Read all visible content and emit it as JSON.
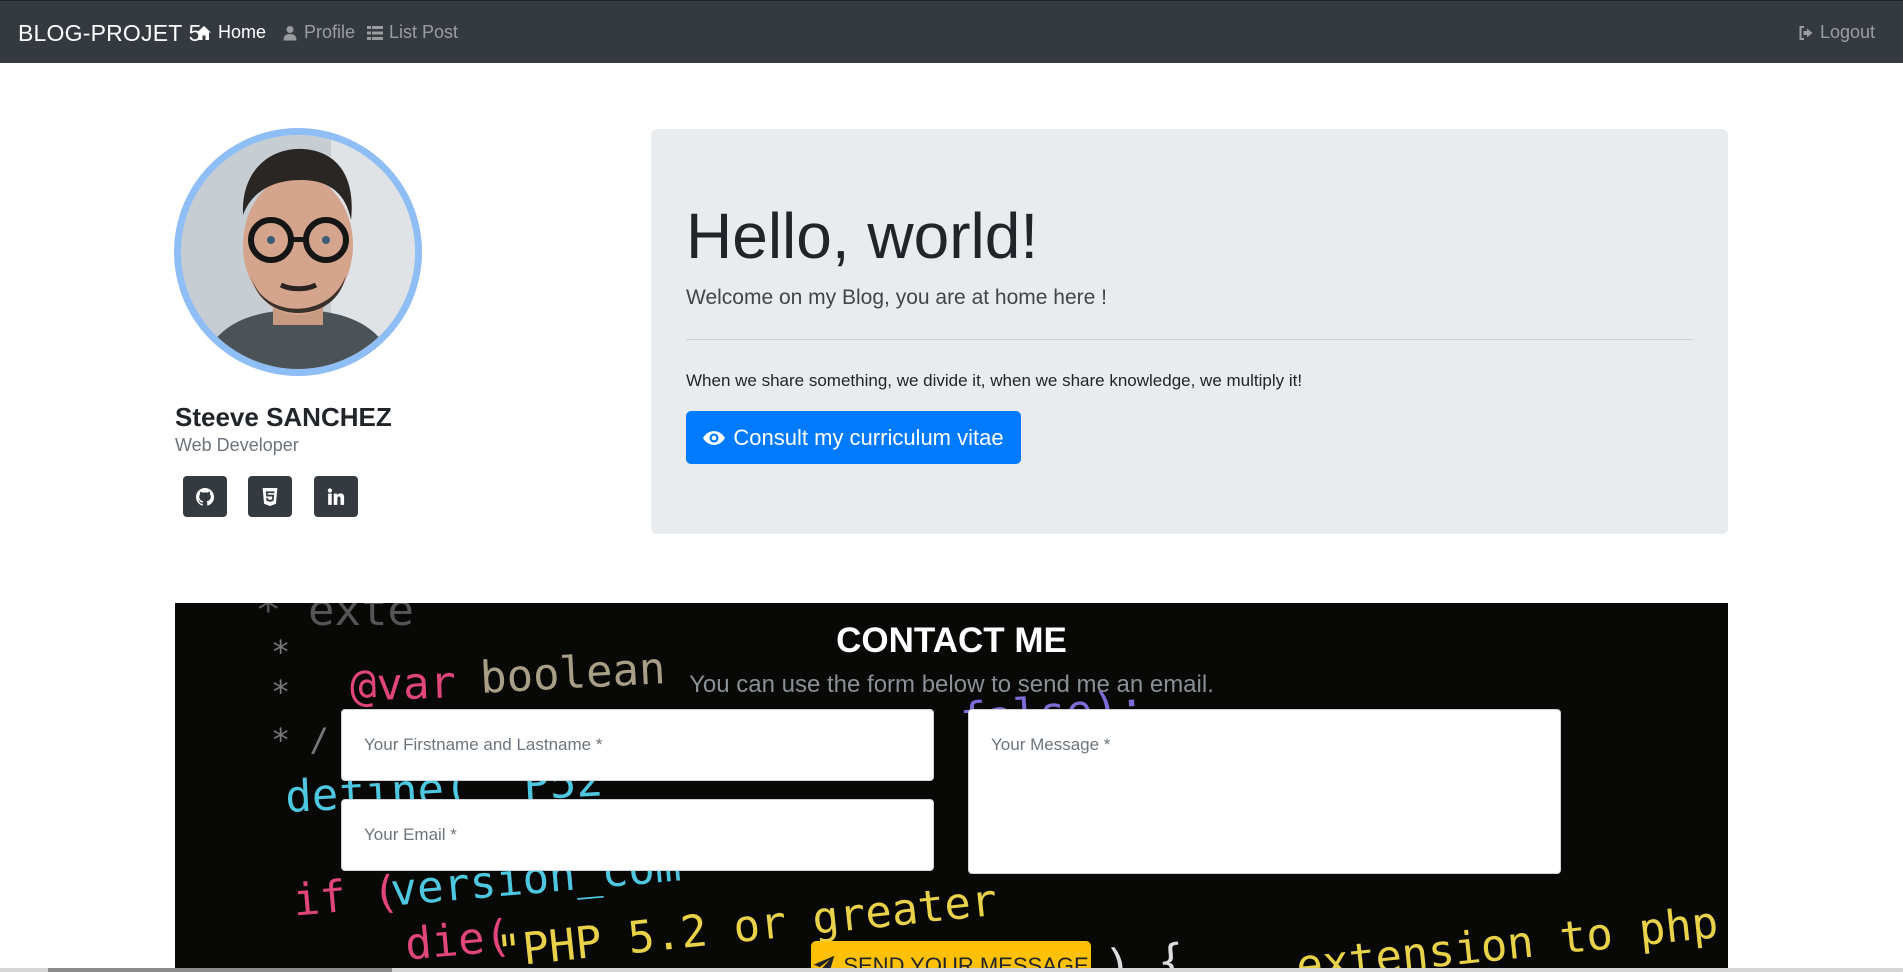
{
  "navbar": {
    "brand": "BLOG-PROJET 5",
    "items": [
      {
        "label": "Home",
        "icon": "home-icon",
        "active": true
      },
      {
        "label": "Profile",
        "icon": "user-icon",
        "active": false
      },
      {
        "label": "List Post",
        "icon": "list-icon",
        "active": false
      }
    ],
    "logout": {
      "label": "Logout",
      "icon": "sign-out-icon"
    }
  },
  "profile": {
    "name": "Steeve SANCHEZ",
    "role": "Web Developer",
    "social": [
      {
        "icon": "github-icon"
      },
      {
        "icon": "html5-icon"
      },
      {
        "icon": "linkedin-icon"
      }
    ]
  },
  "jumbotron": {
    "title": "Hello, world!",
    "lead": "Welcome on my Blog, you are at home here !",
    "text": "When we share something, we divide it, when we share knowledge, we multiply it!",
    "button": {
      "label": "Consult my curriculum vitae",
      "icon": "eye-icon"
    }
  },
  "contact": {
    "title": "CONTACT ME",
    "subtitle": "You can use the form below to send me an email.",
    "name_placeholder": "Your Firstname and Lastname *",
    "email_placeholder": "Your Email *",
    "message_placeholder": "Your Message *",
    "send_label": "SEND YOUR MESSAGE",
    "send_icon": "paper-plane-icon"
  },
  "colors": {
    "navbar": "#343a40",
    "primary": "#007bff",
    "warning": "#ffc107",
    "jumbotron": "#e9ecef"
  }
}
